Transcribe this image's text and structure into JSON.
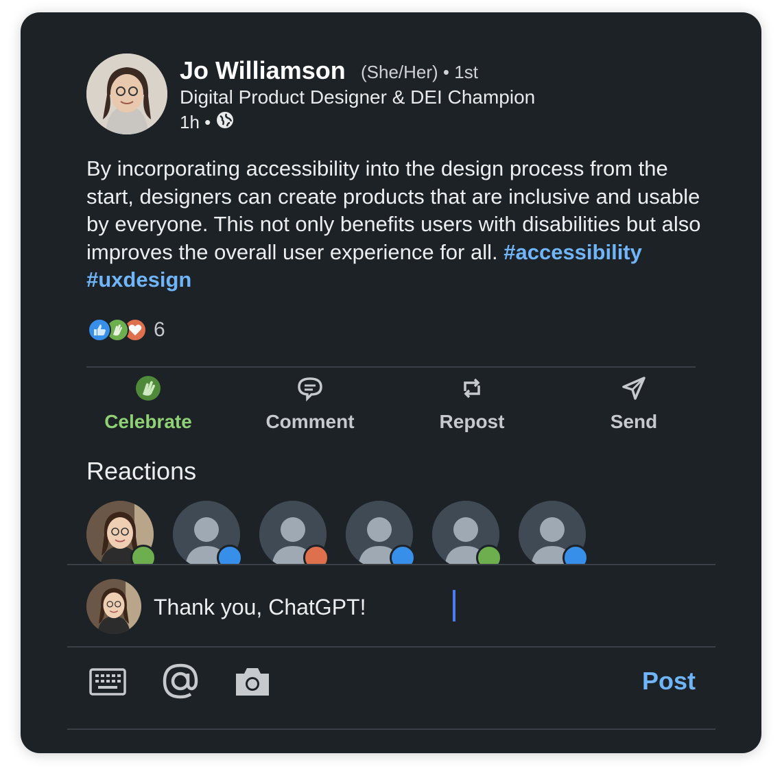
{
  "post": {
    "author_name": "Jo Williamson",
    "pronouns": "(She/Her) • 1st",
    "headline": "Digital Product Designer & DEI Champion",
    "time": "1h •",
    "visibility_icon": "globe-icon",
    "text": "By incorporating accessibility into the design process from the start, designers can create products that are inclusive and usable by everyone. This not only benefits users with disabilities but also improves the overall user experience for all. ",
    "hashtags": [
      "#accessibility",
      "#uxdesign"
    ],
    "reaction_count": "6",
    "reaction_icons": [
      "like-icon",
      "celebrate-icon",
      "love-icon"
    ]
  },
  "actions": {
    "celebrate": "Celebrate",
    "comment": "Comment",
    "repost": "Repost",
    "send": "Send"
  },
  "reactions_section": {
    "title": "Reactions",
    "reactors": [
      {
        "avatar": "photo",
        "reaction": "celebrate-icon"
      },
      {
        "avatar": "default",
        "reaction": "like-icon"
      },
      {
        "avatar": "default",
        "reaction": "love-icon"
      },
      {
        "avatar": "default",
        "reaction": "like-icon"
      },
      {
        "avatar": "default",
        "reaction": "celebrate-icon"
      },
      {
        "avatar": "default",
        "reaction": "like-icon"
      }
    ]
  },
  "comment": {
    "value": "Thank you, ChatGPT!"
  },
  "toolbar": {
    "post_label": "Post"
  },
  "colors": {
    "card_bg": "#1d2226",
    "link_blue": "#70b5f9",
    "celebrate_green": "#8fd174",
    "love_red": "#df704d",
    "like_blue": "#378fe9",
    "caret_blue": "#4c7df0"
  }
}
